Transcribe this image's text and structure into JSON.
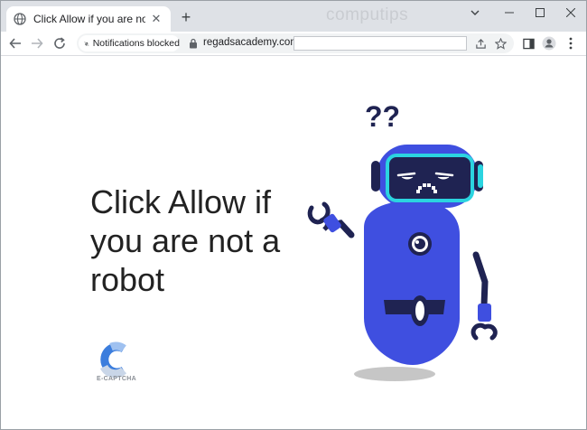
{
  "browser": {
    "tab": {
      "title": "Click Allow if you are not a robot",
      "favicon": "globe-icon"
    },
    "new_tab_icon": "plus-icon",
    "watermark": "computips",
    "window_controls": [
      "chevron-down-icon",
      "minimize-icon",
      "maximize-icon",
      "close-icon"
    ]
  },
  "toolbar": {
    "notification_chip": "Notifications blocked",
    "url": "regadsacademy.com/",
    "icons": [
      "back-icon",
      "forward-icon",
      "reload-icon",
      "share-icon",
      "star-icon",
      "sidepanel-icon",
      "profile-icon",
      "menu-icon"
    ]
  },
  "page": {
    "headline": "Click Allow if you are not a robot",
    "logo_text": "E-CAPTCHA",
    "illustration": "confused-robot"
  },
  "colors": {
    "tabstrip": "#dee1e6",
    "robot_body": "#3f4fe0",
    "robot_dark": "#1f2352",
    "visor": "#2bd4e0",
    "logo_blue": "#3b7ddd"
  }
}
